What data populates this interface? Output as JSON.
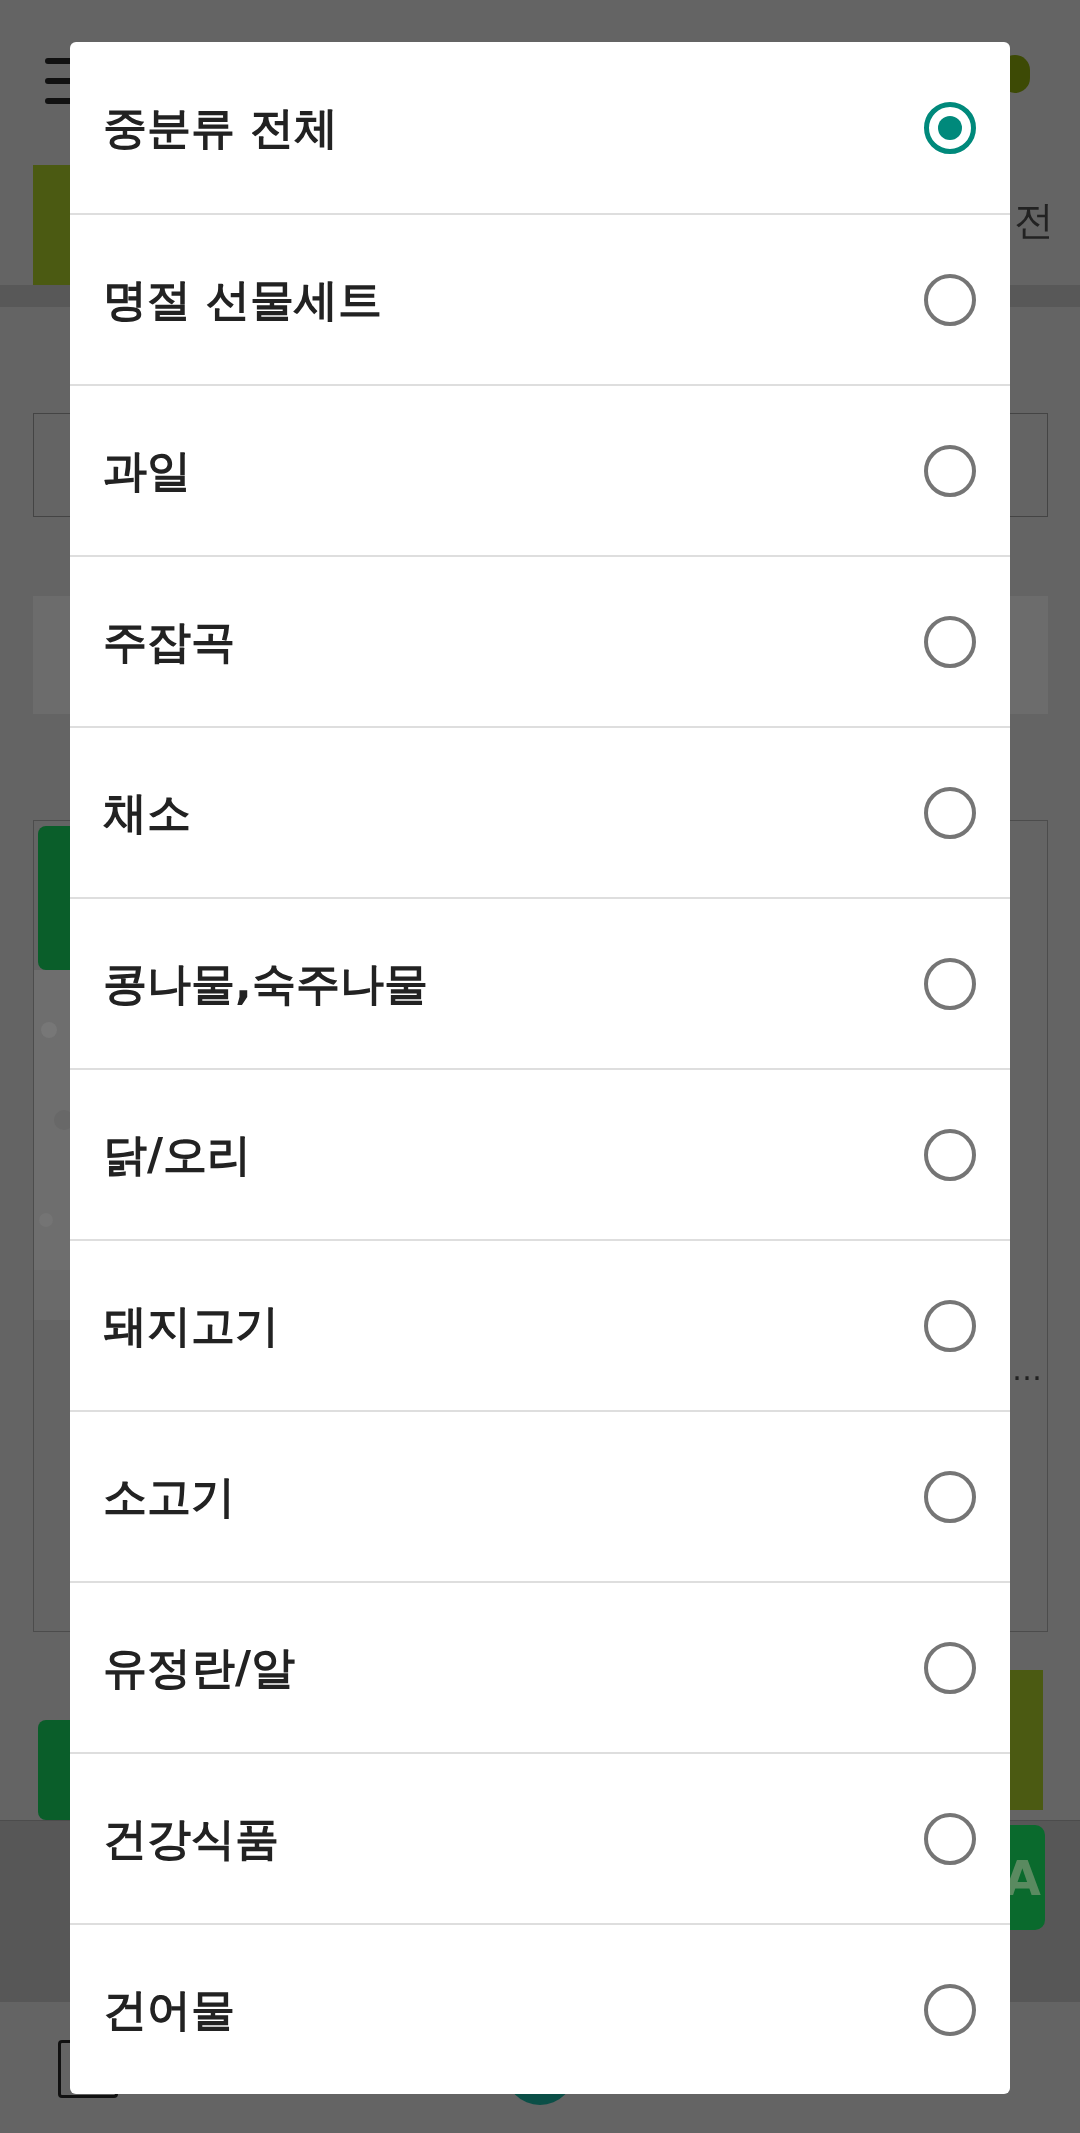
{
  "background": {
    "header_text": "전",
    "ellipsis": "…",
    "button_label": "A"
  },
  "dialog": {
    "options": [
      {
        "label": "중분류 전체",
        "selected": true
      },
      {
        "label": "명절 선물세트",
        "selected": false
      },
      {
        "label": "과일",
        "selected": false
      },
      {
        "label": "주잡곡",
        "selected": false
      },
      {
        "label": "채소",
        "selected": false
      },
      {
        "label": "콩나물,숙주나물",
        "selected": false
      },
      {
        "label": "닭/오리",
        "selected": false
      },
      {
        "label": "돼지고기",
        "selected": false
      },
      {
        "label": "소고기",
        "selected": false
      },
      {
        "label": "유정란/알",
        "selected": false
      },
      {
        "label": "건강식품",
        "selected": false
      },
      {
        "label": "건어물",
        "selected": false
      }
    ]
  }
}
